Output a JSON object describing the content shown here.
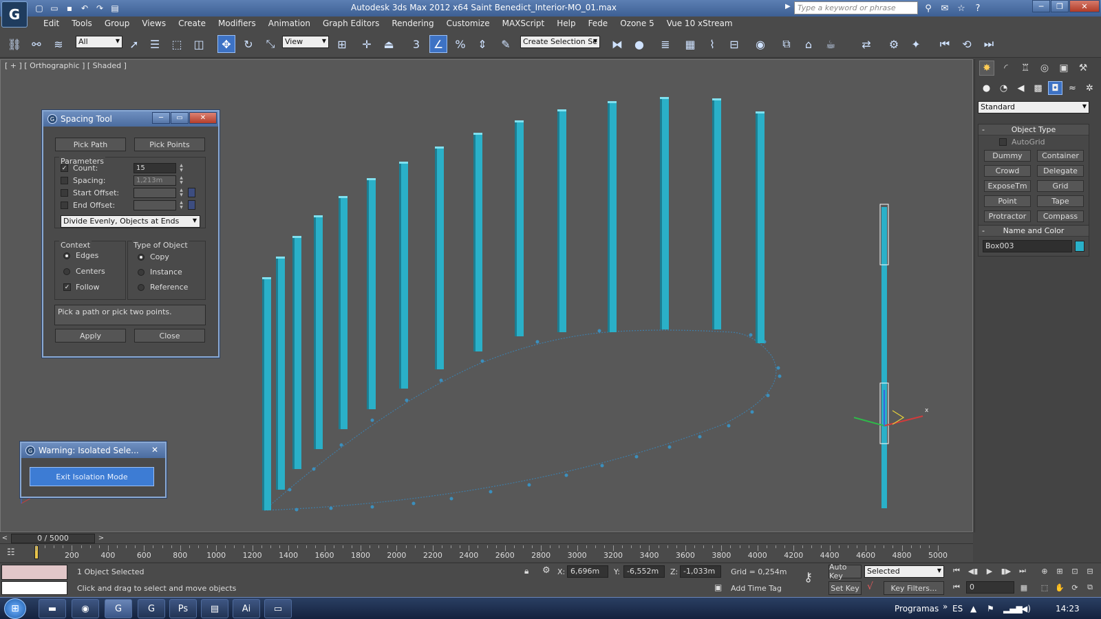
{
  "window": {
    "app_logo": "G",
    "title": "Autodesk 3ds Max  2012 x64      Saint Benedict_Interior-MO_01.max",
    "search_placeholder": "Type a keyword or phrase"
  },
  "menu": [
    "Edit",
    "Tools",
    "Group",
    "Views",
    "Create",
    "Modifiers",
    "Animation",
    "Graph Editors",
    "Rendering",
    "Customize",
    "MAXScript",
    "Help",
    "Fede",
    "Ozone 5",
    "Vue 10 xStream"
  ],
  "toolbar": {
    "filter_select": "All",
    "coord_select": "View",
    "selection_set_placeholder": "Create Selection Se"
  },
  "viewport": {
    "label": "[ + ] [ Orthographic ] [ Shaded ]"
  },
  "command_panel": {
    "category_dropdown": "Standard",
    "object_type": {
      "header": "Object Type",
      "autogrid_label": "AutoGrid",
      "autogrid_checked": false,
      "buttons": [
        "Dummy",
        "Container",
        "Crowd",
        "Delegate",
        "ExposeTm",
        "Grid",
        "Point",
        "Tape",
        "Protractor",
        "Compass"
      ]
    },
    "name_and_color": {
      "header": "Name and Color",
      "name": "Box003",
      "color": "#2ab0c8"
    }
  },
  "spacing_tool": {
    "title": "Spacing Tool",
    "pick_path": "Pick Path",
    "pick_points": "Pick Points",
    "parameters_label": "Parameters",
    "count_label": "Count:",
    "count_value": "15",
    "count_checked": true,
    "spacing_label": "Spacing:",
    "spacing_value": "1,213m",
    "spacing_checked": false,
    "start_offset_label": "Start Offset:",
    "start_offset_checked": false,
    "end_offset_label": "End Offset:",
    "end_offset_checked": false,
    "distribution": "Divide Evenly, Objects at Ends",
    "context_label": "Context",
    "context_options": [
      {
        "label": "Edges",
        "type": "radio",
        "on": true
      },
      {
        "label": "Centers",
        "type": "radio",
        "on": false
      },
      {
        "label": "Follow",
        "type": "check",
        "on": true
      }
    ],
    "type_label": "Type of Object",
    "type_options": [
      {
        "label": "Copy",
        "on": true
      },
      {
        "label": "Instance",
        "on": false
      },
      {
        "label": "Reference",
        "on": false
      }
    ],
    "message": "Pick a path or pick two points.",
    "apply": "Apply",
    "close": "Close"
  },
  "warning_dialog": {
    "title": "Warning: Isolated Sele...",
    "exit_button": "Exit Isolation Mode"
  },
  "time_slider": {
    "position": "0 / 5000",
    "current_frame": 0,
    "total_frames": 5000
  },
  "trackbar": {
    "ticks": [
      "200",
      "400",
      "600",
      "800",
      "1000",
      "1200",
      "1400",
      "1600",
      "1800",
      "2000",
      "2200",
      "2400",
      "2600",
      "2800",
      "3000",
      "3200",
      "3400",
      "3600",
      "3800",
      "4000",
      "4200",
      "4400",
      "4600",
      "4800",
      "5000"
    ]
  },
  "status": {
    "selection_info": "1 Object Selected",
    "prompt": "Click and drag to select and move objects",
    "x_label": "X:",
    "x_value": "6,696m",
    "y_label": "Y:",
    "y_value": "-6,552m",
    "z_label": "Z:",
    "z_value": "-1,033m",
    "grid": "Grid = 0,254m",
    "add_time_tag": "Add Time Tag",
    "auto_key": "Auto Key",
    "set_key": "Set Key",
    "key_mode": "Selected",
    "key_filters": "Key Filters...",
    "frame_value": "0"
  },
  "taskbar": {
    "programs": "Programas",
    "lang": "ES",
    "clock": "14:23",
    "apps": [
      "explorer-icon",
      "chrome-icon",
      "3dsmax-icon",
      "3dsmax2-icon",
      "photoshop-icon",
      "notepad-icon",
      "illustrator-icon",
      "window-icon"
    ]
  }
}
